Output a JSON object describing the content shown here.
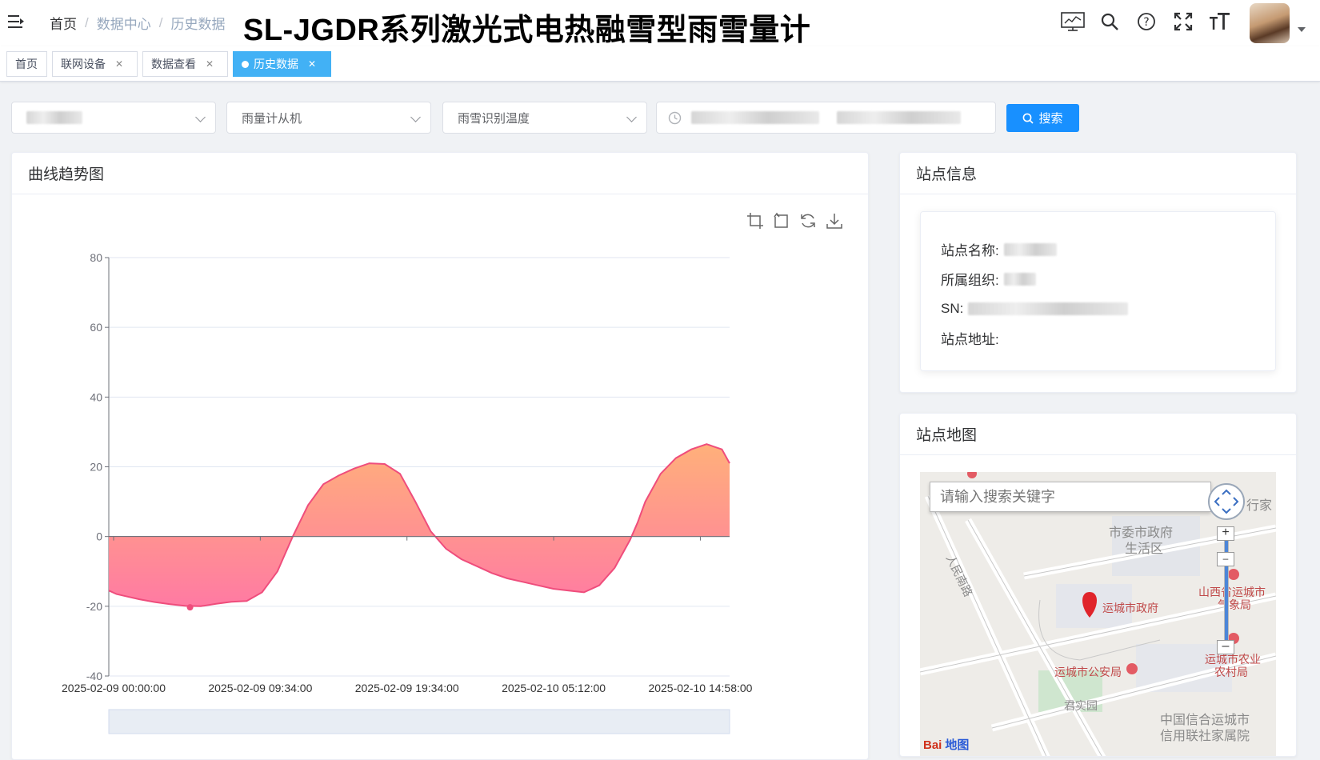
{
  "header": {
    "breadcrumb": [
      "首页",
      "数据中心",
      "历史数据"
    ],
    "title": "SL-JGDR系列激光式电热融雪型雨雪量计"
  },
  "tags": [
    {
      "label": "首页",
      "active": false
    },
    {
      "label": "联网设备",
      "active": false
    },
    {
      "label": "数据查看",
      "active": false
    },
    {
      "label": "历史数据",
      "active": true
    }
  ],
  "filters": {
    "device_type": "雨量计从机",
    "metric": "雨雪识别温度",
    "search_label": "搜索"
  },
  "chart_card": {
    "title": "曲线趋势图"
  },
  "chart_data": {
    "type": "area",
    "title": "",
    "xlabel": "",
    "ylabel": "",
    "ylim": [
      -40,
      80
    ],
    "yticks": [
      80,
      60,
      40,
      20,
      0,
      -20,
      -40
    ],
    "xticks": [
      "2025-02-09 00:00:00",
      "2025-02-09 09:34:00",
      "2025-02-09 19:34:00",
      "2025-02-10 05:12:00",
      "2025-02-10 14:58:00"
    ],
    "series": [
      {
        "name": "",
        "x_hours": [
          0,
          0.5,
          1,
          2,
          3,
          4,
          5,
          6,
          7,
          8,
          9,
          10,
          11,
          11.5,
          12,
          13,
          14,
          15,
          16,
          17,
          18,
          19,
          20,
          21,
          22,
          23,
          24,
          25,
          26,
          27,
          28,
          29,
          30,
          31,
          32,
          33,
          33.5,
          34,
          34.5,
          35,
          36,
          37,
          38,
          39,
          40,
          40.5
        ],
        "values": [
          -15.5,
          -16.5,
          -17,
          -18,
          -18.8,
          -19.4,
          -19.9,
          -20,
          -19.3,
          -18.7,
          -18.5,
          -16,
          -10,
          -5,
          0,
          9,
          15,
          17.5,
          19.5,
          21,
          20.8,
          18,
          10,
          1.5,
          -3.5,
          -6.5,
          -8.5,
          -10.5,
          -12,
          -13,
          -14,
          -15,
          -15.5,
          -16,
          -14,
          -9,
          -5,
          -1,
          4,
          10,
          18,
          22.5,
          25,
          26.5,
          25,
          21
        ]
      }
    ],
    "colors": {
      "line": "#ef4d7c",
      "area_top": "#ffb07a",
      "area_bottom": "#ff7aa3"
    },
    "grid": true,
    "marker_min": {
      "x_hours": 5.3,
      "value": -20.3
    }
  },
  "info_card": {
    "title": "站点信息",
    "rows": [
      {
        "label": "站点名称:"
      },
      {
        "label": "所属组织:"
      },
      {
        "label": "SN:"
      },
      {
        "label": "站点地址:"
      }
    ]
  },
  "map_card": {
    "title": "站点地图",
    "search_placeholder": "请输入搜索关键字",
    "labels": [
      "市委市政府",
      "生活区",
      "人民南路",
      "运城市政府",
      "山西省运城市",
      "气象局",
      "运城市农业",
      "农村局",
      "运城市公安局",
      "君实园",
      "中国信合运城市",
      "信用联社家属院",
      "行家"
    ],
    "logo": "Bai",
    "logo_suffix": "地图"
  }
}
